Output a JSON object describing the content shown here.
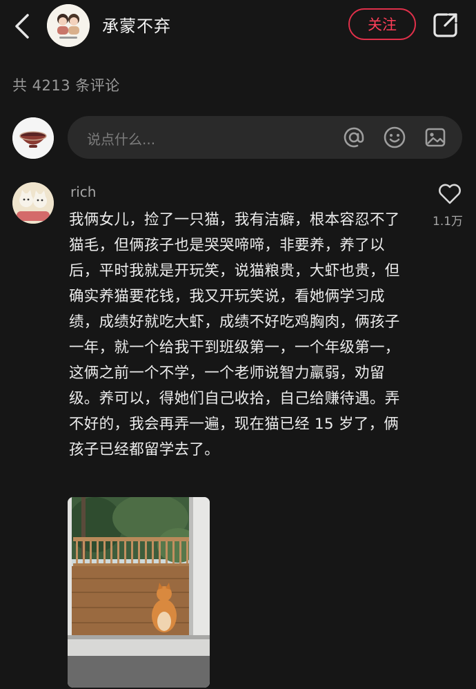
{
  "header": {
    "author_name": "承蒙不弃",
    "follow_label": "关注"
  },
  "comments_header": {
    "count_text": "共 4213 条评论"
  },
  "comment_input": {
    "placeholder": "说点什么..."
  },
  "comment": {
    "username": "rich",
    "text": "我俩女儿，捡了一只猫，我有洁癖，根本容忍不了猫毛，但俩孩子也是哭哭啼啼，非要养，养了以后，平时我就是开玩笑，说猫粮贵，大虾也贵，但确实养猫要花钱，我又开玩笑说，看她俩学习成绩，成绩好就吃大虾，成绩不好吃鸡胸肉，俩孩子一年，就一个给我干到班级第一，一个年级第一，这俩之前一个不学，一个老师说智力羸弱，劝留级。养可以，得她们自己收拾，自己给赚待遇。弄不好的，我会再弄一遍，现在猫已经 15 岁了，俩孩子已经都留学去了。",
    "like_count": "1.1万"
  },
  "colors": {
    "background": "#161616",
    "follow_accent": "#e0304a",
    "input_bg": "#2a2a2a",
    "muted_text": "#9a9a9a"
  },
  "icons": [
    "back-icon",
    "share-icon",
    "at-icon",
    "emoji-icon",
    "image-icon",
    "heart-icon"
  ]
}
